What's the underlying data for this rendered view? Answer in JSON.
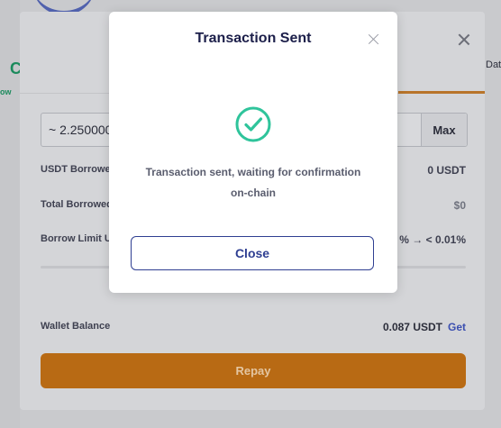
{
  "background": {
    "partial_green_text": "C",
    "partial_green_small": "ow",
    "partial_tab_text": "Dat"
  },
  "repay_modal": {
    "amount_value": "~ 2.250000",
    "max_label": "Max",
    "rows": {
      "usdt_borrowed": {
        "label": "USDT Borrowed",
        "value": "0 USDT"
      },
      "total_borrowed": {
        "label": "Total Borrowed",
        "value": "$0"
      },
      "borrow_limit": {
        "label": "Borrow Limit Used",
        "value": "% → < 0.01%"
      },
      "wallet_balance": {
        "label": "Wallet Balance",
        "value": "0.087 USDT",
        "link": "Get"
      }
    },
    "repay_label": "Repay",
    "colors": {
      "accent": "#b86a14",
      "link": "#3b4fb0"
    }
  },
  "dialog": {
    "title": "Transaction Sent",
    "icon": "check-circle-icon",
    "message": "Transaction sent, waiting for confirmation on-chain",
    "close_label": "Close",
    "colors": {
      "success": "#2fc49b",
      "primary": "#2f3f92"
    }
  }
}
